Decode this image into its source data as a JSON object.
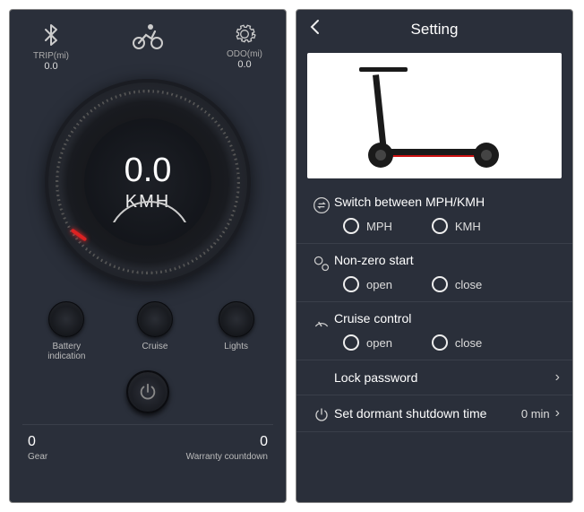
{
  "dashboard": {
    "trip": {
      "label": "TRIP(mi)",
      "value": "0.0"
    },
    "odo": {
      "label": "ODO(mi)",
      "value": "0.0"
    },
    "speed": {
      "value": "0.0",
      "unit": "KMH"
    },
    "buttons": {
      "battery": "Battery indication",
      "cruise": "Cruise",
      "lights": "Lights"
    },
    "gear": {
      "value": "0",
      "label": "Gear"
    },
    "warranty": {
      "value": "0",
      "label": "Warranty countdown"
    }
  },
  "settings": {
    "title": "Setting",
    "unit_row": {
      "label": "Switch between MPH/KMH",
      "opt1": "MPH",
      "opt2": "KMH"
    },
    "nonzero_row": {
      "label": "Non-zero start",
      "opt1": "open",
      "opt2": "close"
    },
    "cruise_row": {
      "label": "Cruise control",
      "opt1": "open",
      "opt2": "close"
    },
    "lock_row": {
      "label": "Lock password"
    },
    "dormant_row": {
      "label": "Set dormant shutdown time",
      "value": "0 min"
    }
  }
}
